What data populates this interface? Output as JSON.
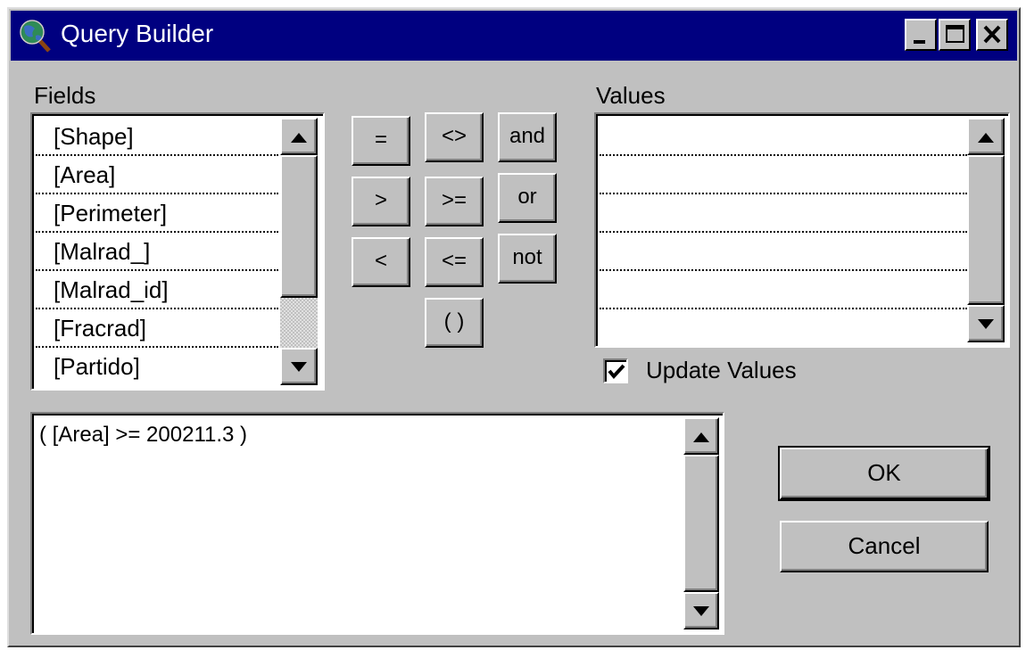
{
  "window": {
    "title": "Query Builder"
  },
  "fields": {
    "label": "Fields",
    "items": [
      "[Shape]",
      "[Area]",
      "[Perimeter]",
      "[Malrad_]",
      "[Malrad_id]",
      "[Fracrad]",
      "[Partido]"
    ]
  },
  "operators": {
    "equals": "=",
    "not_equal": "<>",
    "and": "and",
    "greater": ">",
    "greater_equal": ">=",
    "or": "or",
    "less": "<",
    "less_equal": "<=",
    "not": "not",
    "parens": "( )"
  },
  "values": {
    "label": "Values",
    "items": []
  },
  "update_values": {
    "label": "Update Values",
    "checked": true
  },
  "expression": {
    "text": "( [Area] >= 200211.3 )"
  },
  "buttons": {
    "ok": "OK",
    "cancel": "Cancel"
  },
  "colors": {
    "titlebar": "#000080",
    "face": "#c0c0c0"
  }
}
